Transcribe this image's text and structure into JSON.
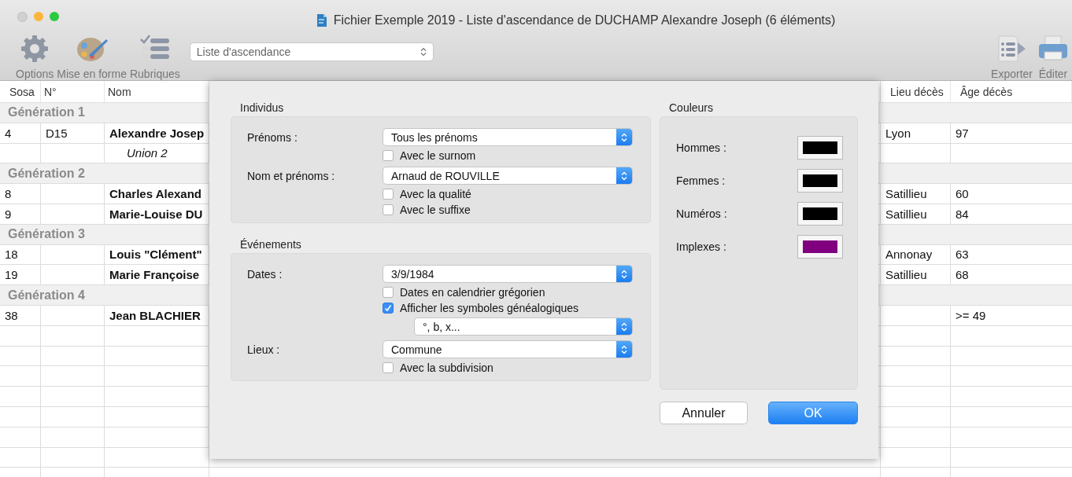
{
  "window": {
    "title": "Fichier Exemple 2019 - Liste d'ascendance de DUCHAMP Alexandre Joseph (6 éléments)"
  },
  "toolbar": {
    "left_buttons": [
      {
        "kind": "gear",
        "label": "Options"
      },
      {
        "kind": "palette",
        "label": "Mise en forme"
      },
      {
        "kind": "checklist",
        "label": "Rubriques"
      }
    ],
    "view_select": {
      "value": "Liste d'ascendance"
    },
    "right_buttons": [
      {
        "kind": "export",
        "label": "Exporter"
      },
      {
        "kind": "printer",
        "label": "Éditer"
      }
    ]
  },
  "table": {
    "columns_left": [
      "Sosa",
      "N°",
      "Nom"
    ],
    "columns_right": [
      "Lieu décès",
      "Âge décès"
    ],
    "rows": [
      {
        "kind": "generation",
        "label": "Génération 1"
      },
      {
        "kind": "person",
        "sosa": "4",
        "number": "D15",
        "name": "Alexandre Josep",
        "place": "Lyon",
        "age": "97"
      },
      {
        "kind": "union",
        "name": "Union 2"
      },
      {
        "kind": "generation",
        "label": "Génération 2"
      },
      {
        "kind": "person",
        "sosa": "8",
        "name": "Charles Alexand",
        "place": "Satillieu",
        "age": "60"
      },
      {
        "kind": "person",
        "sosa": "9",
        "name": "Marie-Louise DU",
        "place": "Satillieu",
        "age": "84"
      },
      {
        "kind": "generation",
        "label": "Génération 3"
      },
      {
        "kind": "person",
        "sosa": "18",
        "name": "Louis \"Clément\"",
        "place": "Annonay",
        "age": "63"
      },
      {
        "kind": "person",
        "sosa": "19",
        "name": "Marie Françoise",
        "place": "Satillieu",
        "age": "68"
      },
      {
        "kind": "generation",
        "label": "Génération 4"
      },
      {
        "kind": "person",
        "sosa": "38",
        "name": "Jean BLACHIER",
        "age": ">= 49"
      }
    ]
  },
  "dialog": {
    "individus": {
      "title": "Individus",
      "fields": [
        {
          "label": "Prénoms :",
          "select": {
            "value": "Tous les prénoms"
          },
          "options": [
            {
              "label": "Avec le surnom",
              "checked": false
            }
          ]
        },
        {
          "label": "Nom et prénoms :",
          "select": {
            "value": "Arnaud de ROUVILLE"
          },
          "options": [
            {
              "label": "Avec la qualité",
              "checked": false
            },
            {
              "label": "Avec le suffixe",
              "checked": false
            }
          ]
        }
      ]
    },
    "evenements": {
      "title": "Événements",
      "fields": [
        {
          "label": "Dates :",
          "select": {
            "value": "3/9/1984"
          },
          "options": [
            {
              "label": "Dates en calendrier grégorien",
              "checked": false
            },
            {
              "label": "Afficher les symboles généalogiques",
              "checked": true,
              "select": {
                "value": "°, b, x..."
              }
            }
          ]
        },
        {
          "label": "Lieux :",
          "select": {
            "value": "Commune"
          },
          "options": [
            {
              "label": "Avec la subdivision",
              "checked": false
            }
          ]
        }
      ]
    },
    "couleurs": {
      "title": "Couleurs",
      "items": [
        {
          "label": "Hommes :",
          "color": "#000000"
        },
        {
          "label": "Femmes :",
          "color": "#000000"
        },
        {
          "label": "Numéros :",
          "color": "#000000"
        },
        {
          "label": "Implexes :",
          "color": "#800080"
        }
      ]
    },
    "buttons": [
      {
        "kind": "cancel",
        "label": "Annuler"
      },
      {
        "kind": "default",
        "label": "OK"
      }
    ]
  }
}
